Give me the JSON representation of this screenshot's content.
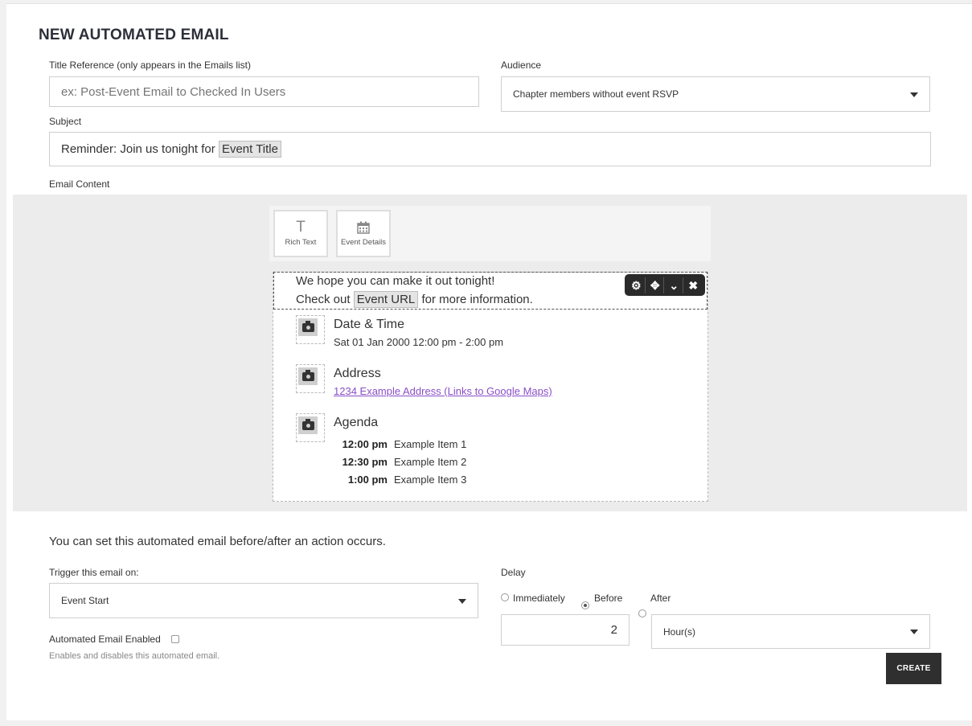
{
  "page": {
    "title": "NEW AUTOMATED EMAIL"
  },
  "form": {
    "title_reference": {
      "label": "Title Reference (only appears in the Emails list)",
      "placeholder": "ex: Post-Event Email to Checked In Users",
      "value": ""
    },
    "audience": {
      "label": "Audience",
      "value": "Chapter members without event RSVP"
    },
    "subject": {
      "label": "Subject",
      "prefix": "Reminder: Join us tonight for",
      "token": "Event Title"
    },
    "email_content_label": "Email Content"
  },
  "editor": {
    "toolbar": [
      {
        "label": "Rich Text",
        "icon": "T"
      },
      {
        "label": "Event Details",
        "icon": "calendar"
      }
    ],
    "rich_text": {
      "line1": "We hope you can make it out tonight!",
      "line2_prefix": "Check out",
      "line2_token": "Event URL",
      "line2_suffix": "for more information."
    },
    "block_tools": [
      "gear-icon",
      "move-icon",
      "chevron-down-icon",
      "close-icon"
    ],
    "details": {
      "date_time": {
        "title": "Date & Time",
        "value": "Sat 01 Jan 2000 12:00 pm - 2:00 pm"
      },
      "address": {
        "title": "Address",
        "value": "1234 Example Address (Links to Google Maps)"
      },
      "agenda": {
        "title": "Agenda",
        "items": [
          {
            "time": "12:00 pm",
            "item": "Example Item 1"
          },
          {
            "time": "12:30 pm",
            "item": "Example Item 2"
          },
          {
            "time": "1:00 pm",
            "item": "Example Item 3"
          }
        ]
      }
    }
  },
  "trigger": {
    "intro": "You can set this automated email before/after an action occurs.",
    "label": "Trigger this email on:",
    "value": "Event Start",
    "enabled_label": "Automated Email Enabled",
    "enabled_hint": "Enables and disables this automated email."
  },
  "delay": {
    "label": "Delay",
    "options": [
      "Immediately",
      "Before",
      "After"
    ],
    "selected": "Before",
    "amount": "2",
    "unit": "Hour(s)"
  },
  "actions": {
    "create_label": "CREATE"
  }
}
